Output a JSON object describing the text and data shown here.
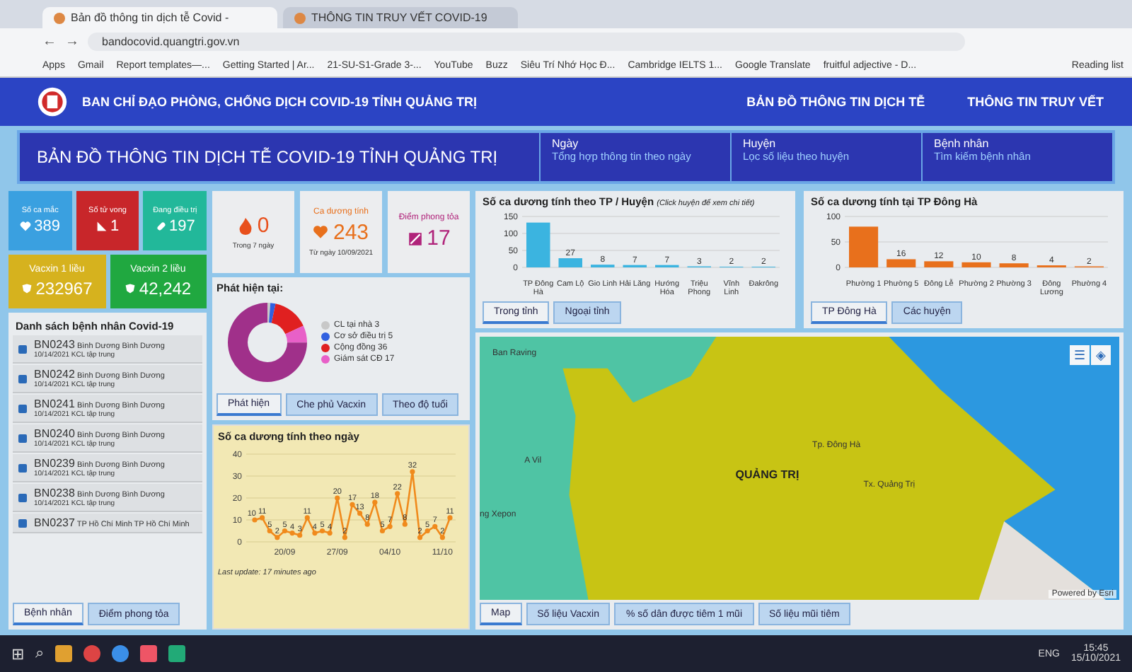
{
  "browser": {
    "tabs": [
      {
        "label": "Bản đồ thông tin dịch tễ Covid -",
        "selected": true
      },
      {
        "label": "THÔNG TIN TRUY VẾT COVID-19",
        "selected": false
      }
    ],
    "url": "bandocovid.quangtri.gov.vn",
    "bookmarks": [
      "Apps",
      "Gmail",
      "Report templates—...",
      "Getting Started | Ar...",
      "21-SU-S1-Grade 3-...",
      "YouTube",
      "Buzz",
      "Siêu Trí Nhớ Học Đ...",
      "Cambridge IELTS 1...",
      "Google Translate",
      "fruitful adjective - D..."
    ],
    "reading_list": "Reading list"
  },
  "header": {
    "title": "BAN CHỈ ĐẠO PHÒNG, CHỐNG DỊCH COVID-19 TỈNH QUẢNG TRỊ",
    "nav": [
      "BẢN ĐỒ THÔNG TIN DỊCH TỄ",
      "THÔNG TIN TRUY VẾT"
    ]
  },
  "title_bar": {
    "title": "BẢN ĐỒ THÔNG TIN DỊCH TỄ COVID-19 TỈNH QUẢNG TRỊ",
    "menus": [
      {
        "heading": "Ngày",
        "subtitle": "Tổng hợp thông tin theo ngày"
      },
      {
        "heading": "Huyện",
        "subtitle": "Lọc số liệu theo huyện"
      },
      {
        "heading": "Bệnh nhân",
        "subtitle": "Tìm kiếm bệnh nhân"
      }
    ]
  },
  "stat_tiles": [
    {
      "kind": "cases",
      "label": "Số ca mắc",
      "value": "389",
      "color": "#3aa0e0"
    },
    {
      "kind": "deaths",
      "label": "Số tử vong",
      "value": "1",
      "color": "#c8262a"
    },
    {
      "kind": "treating",
      "label": "Đang điều trị",
      "value": "197",
      "color": "#22b89a"
    }
  ],
  "vaccine_tiles": [
    {
      "label": "Vacxin 1 liều",
      "value": "232967",
      "color": "#d6b21e"
    },
    {
      "label": "Vacxin 2 liều",
      "value": "42,242",
      "color": "#20a840"
    }
  ],
  "cards": [
    {
      "kind": "fire",
      "value": "0",
      "note": "Trong 7 ngày",
      "color": "#e8501c"
    },
    {
      "kind": "heart",
      "label": "Ca dương tính",
      "value": "243",
      "note": "Từ ngày 10/09/2021",
      "color": "#e8701c"
    },
    {
      "kind": "lockdown",
      "label": "Điểm phong tỏa",
      "value": "17",
      "color": "#b0237a"
    }
  ],
  "detection": {
    "title": "Phát hiện tại:",
    "legend": [
      {
        "label": "CL tại nhà 3",
        "color": "#c8c8c8"
      },
      {
        "label": "Cơ sở điều trị 5",
        "color": "#3060e0"
      },
      {
        "label": "Cộng đồng 36",
        "color": "#e02020"
      },
      {
        "label": "Giám sát CĐ 17",
        "color": "#e860c8"
      }
    ],
    "slices": [
      {
        "color": "#c8c8c8"
      },
      {
        "color": "#3060e0"
      },
      {
        "color": "#e02020"
      },
      {
        "color": "#e860c8"
      },
      {
        "color": "#a0308a"
      }
    ],
    "chart_data": {
      "type": "donut",
      "values": [
        1.2,
        2.1,
        14.8,
        7.0,
        74.9
      ]
    },
    "tabs": [
      {
        "label": "Phát hiện",
        "selected": true
      },
      {
        "label": "Che phủ Vacxin",
        "selected": false
      },
      {
        "label": "Theo độ tuổi",
        "selected": false
      }
    ]
  },
  "patients": {
    "title": "Danh sách bệnh nhân Covid-19",
    "items": [
      {
        "code": "BN0243",
        "place": "Bình Dương Bình Dương",
        "date": "10/14/2021",
        "status": "KCL tập trung"
      },
      {
        "code": "BN0242",
        "place": "Bình Dương Bình Dương",
        "date": "10/14/2021",
        "status": "KCL tập trung"
      },
      {
        "code": "BN0241",
        "place": "Bình Dương Bình Dương",
        "date": "10/14/2021",
        "status": "KCL tập trung"
      },
      {
        "code": "BN0240",
        "place": "Bình Dương Bình Dương",
        "date": "10/14/2021",
        "status": "KCL tập trung"
      },
      {
        "code": "BN0239",
        "place": "Bình Dương Bình Dương",
        "date": "10/14/2021",
        "status": "KCL tập trung"
      },
      {
        "code": "BN0238",
        "place": "Bình Dương Bình Dương",
        "date": "10/14/2021",
        "status": "KCL tập trung"
      },
      {
        "code": "BN0237",
        "place": "TP Hồ Chí Minh TP Hồ Chí Minh"
      }
    ],
    "tabs": [
      {
        "label": "Bệnh nhân",
        "selected": true
      },
      {
        "label": "Điểm phong tỏa",
        "selected": false
      }
    ]
  },
  "daily": {
    "title": "Số ca dương tính theo ngày",
    "footer": "Last update: 17 minutes ago",
    "chart_data": {
      "type": "line",
      "categories": [
        null,
        null,
        null,
        null,
        "20/09",
        null,
        null,
        null,
        null,
        null,
        null,
        "27/09",
        null,
        null,
        null,
        null,
        null,
        null,
        "04/10",
        null,
        null,
        null,
        null,
        null,
        null,
        "11/10",
        null
      ],
      "series": [
        {
          "color": "#f08a1c",
          "marker": true,
          "values": [
            10,
            11,
            5,
            2,
            5,
            4,
            3,
            11,
            4,
            5,
            4,
            20,
            2,
            17,
            13,
            8,
            18,
            5,
            7,
            22,
            8,
            32,
            2,
            5,
            7,
            2,
            11
          ]
        }
      ],
      "ylim": [
        0,
        40
      ],
      "yticks": [
        0,
        10,
        20,
        30,
        40
      ],
      "grid": true,
      "data_labels": true
    }
  },
  "district": {
    "title": "Số ca dương tính theo TP / Huyện",
    "hint": "(Click huyện để xem chi tiết)",
    "chart_data": {
      "type": "bar",
      "categories": [
        "TP Đông Hà",
        "Cam Lộ",
        "Gio Linh",
        "Hải Lăng",
        "Hướng Hóa",
        "Triệu Phong",
        "Vĩnh Linh",
        "Đakrông"
      ],
      "series": [
        {
          "color": "#3bb4e0",
          "values": [
            132,
            27,
            8,
            7,
            7,
            3,
            2,
            2
          ]
        }
      ],
      "ylim": [
        0,
        150
      ],
      "yticks": [
        0,
        50,
        100,
        150
      ],
      "value_labels": [
        null,
        "27",
        "8",
        "7",
        "7",
        "3",
        "2",
        "2"
      ]
    },
    "tabs": [
      {
        "label": "Trong tỉnh",
        "selected": true
      },
      {
        "label": "Ngoại tỉnh",
        "selected": false
      }
    ]
  },
  "dongha": {
    "title": "Số ca dương tính tại TP Đông Hà",
    "chart_data": {
      "type": "bar",
      "categories": [
        "Phường 1",
        "Phường 5",
        "Đông Lễ",
        "Phường 2",
        "Phường 3",
        "Đông Lương",
        "Phường 4"
      ],
      "series": [
        {
          "color": "#e8701c",
          "values": [
            80,
            16,
            12,
            10,
            8,
            4,
            2
          ]
        }
      ],
      "ylim": [
        0,
        100
      ],
      "yticks": [
        0,
        50,
        100
      ],
      "value_labels": [
        null,
        "16",
        "12",
        "10",
        "8",
        "4",
        "2"
      ]
    },
    "tabs": [
      {
        "label": "TP Đông Hà",
        "selected": true
      },
      {
        "label": "Các huyện",
        "selected": false
      }
    ]
  },
  "map": {
    "labels": [
      {
        "kind": "place",
        "text": "Ban Raving"
      },
      {
        "kind": "place",
        "text": "A Vil"
      },
      {
        "kind": "place",
        "text": "ng Xepon"
      },
      {
        "kind": "region",
        "text": "QUẢNG TRỊ"
      },
      {
        "kind": "place",
        "text": "Tp. Đông Hà"
      },
      {
        "kind": "place",
        "text": "Tx. Quảng Trị"
      }
    ],
    "attribution": "Powered by Esri",
    "icons": [
      "☰",
      "◈"
    ],
    "tabs": [
      {
        "label": "Map",
        "selected": true
      },
      {
        "label": "Số liệu Vacxin",
        "selected": false
      },
      {
        "label": "% số dân được tiêm 1 mũi",
        "selected": false
      },
      {
        "label": "Số liệu mũi tiêm",
        "selected": false
      }
    ]
  },
  "browser_nav": [
    "←",
    "→"
  ],
  "taskbar": {
    "glyphs": [
      "⊞",
      "⌕"
    ],
    "language": "ENG",
    "time": "15:45",
    "date": "15/10/2021"
  }
}
